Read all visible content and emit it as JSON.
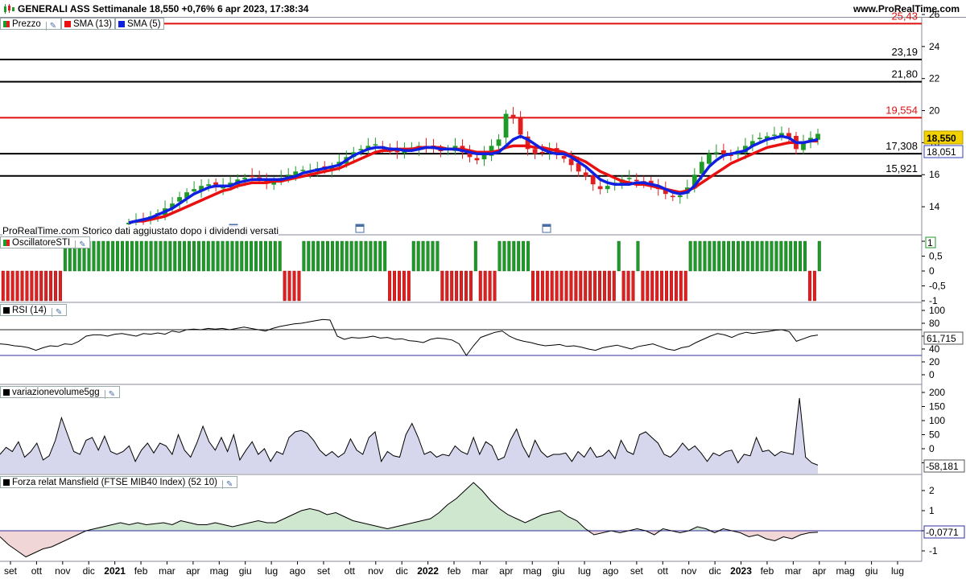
{
  "header": {
    "title": "GENERALI ASS Settimanale 18,550 +0,76% 6 apr 2023, 17:38:34",
    "site": "www.ProRealTime.com"
  },
  "colors": {
    "up": "#1e9a28",
    "down": "#e02020",
    "sma13": "#e81010",
    "sma5": "#1020e0",
    "hline_black": "#000000",
    "hline_red": "#e01010",
    "panel_border": "#8a8a9a",
    "area_fill": "#d6d6ec",
    "green_fill": "#cfe6cf",
    "red_fill": "#f0d6d6",
    "blue_line": "#3030a0"
  },
  "legends": {
    "price": "Prezzo",
    "sma13": "SMA (13)",
    "sma5": "SMA (5)",
    "sti": "OscillatoreSTI",
    "rsi": "RSI (14)",
    "vol": "variazionevolume5gg",
    "mansfield": "Forza relat Mansfield (FTSE MIB40 Index) (52 10)"
  },
  "note": "ProRealTime.com  Storico dati aggiustato dopo i dividendi versati",
  "icons": [
    "wrench-icon",
    "calendar-icon"
  ],
  "chart_data": [
    {
      "type": "candlestick",
      "title": "GENERALI ASS Settimanale",
      "ylim": [
        13,
        26
      ],
      "y_ticks": [
        "14",
        "16",
        "18",
        "20",
        "22",
        "24",
        "26"
      ],
      "horizontal_lines": [
        {
          "value": 25.43,
          "label": "25,43",
          "color": "red"
        },
        {
          "value": 23.19,
          "label": "23,19",
          "color": "black"
        },
        {
          "value": 21.8,
          "label": "21,80",
          "color": "black"
        },
        {
          "value": 19.554,
          "label": "19,554",
          "color": "red"
        },
        {
          "value": 17.308,
          "label": "17,308",
          "color": "black"
        },
        {
          "value": 15.921,
          "label": "15,921",
          "color": "black"
        }
      ],
      "last_price": "18,550",
      "sma_value": "18,051",
      "closes": [
        13.0,
        13.1,
        13.2,
        13.4,
        13.6,
        13.9,
        14.2,
        14.6,
        14.9,
        15.1,
        15.3,
        15.4,
        15.2,
        15.3,
        15.5,
        15.7,
        15.8,
        15.9,
        15.7,
        15.5,
        15.6,
        15.8,
        16.0,
        16.2,
        16.3,
        16.2,
        16.4,
        16.3,
        16.5,
        16.8,
        17.1,
        17.4,
        17.6,
        17.8,
        17.9,
        17.7,
        17.5,
        17.4,
        17.6,
        17.7,
        17.8,
        17.7,
        17.6,
        17.5,
        17.6,
        17.8,
        17.4,
        17.1,
        16.9,
        17.3,
        17.8,
        18.2,
        19.8,
        19.5,
        18.5,
        17.6,
        17.3,
        17.4,
        17.6,
        17.3,
        17.0,
        16.6,
        16.2,
        15.9,
        15.4,
        15.1,
        15.3,
        15.5,
        15.7,
        15.8,
        15.6,
        15.5,
        15.3,
        15.1,
        14.8,
        14.6,
        14.7,
        15.2,
        16.0,
        16.8,
        17.3,
        17.4,
        17.3,
        17.2,
        17.5,
        17.8,
        18.1,
        18.3,
        18.4,
        18.5,
        18.6,
        18.3,
        17.6,
        18.0,
        18.3,
        18.55
      ],
      "sma13": [
        13.0,
        13.1,
        13.1,
        13.2,
        13.3,
        13.4,
        13.6,
        13.8,
        14.0,
        14.2,
        14.4,
        14.6,
        14.8,
        15.0,
        15.1,
        15.3,
        15.4,
        15.5,
        15.5,
        15.5,
        15.6,
        15.6,
        15.7,
        15.8,
        15.9,
        16.0,
        16.1,
        16.2,
        16.3,
        16.4,
        16.6,
        16.8,
        17.0,
        17.2,
        17.4,
        17.5,
        17.5,
        17.6,
        17.6,
        17.6,
        17.7,
        17.7,
        17.7,
        17.7,
        17.6,
        17.6,
        17.6,
        17.5,
        17.4,
        17.4,
        17.4,
        17.5,
        17.7,
        17.8,
        17.8,
        17.8,
        17.7,
        17.7,
        17.6,
        17.5,
        17.4,
        17.2,
        17.0,
        16.8,
        16.5,
        16.2,
        16.0,
        15.8,
        15.6,
        15.5,
        15.4,
        15.4,
        15.3,
        15.2,
        15.1,
        15.0,
        14.9,
        15.0,
        15.2,
        15.5,
        15.8,
        16.1,
        16.4,
        16.7,
        16.9,
        17.1,
        17.3,
        17.5,
        17.7,
        17.8,
        17.9,
        18.0,
        18.0,
        18.0,
        18.1,
        18.1
      ],
      "sma5": [
        13.0,
        13.1,
        13.2,
        13.3,
        13.5,
        13.7,
        13.9,
        14.2,
        14.5,
        14.8,
        15.0,
        15.2,
        15.3,
        15.3,
        15.3,
        15.5,
        15.6,
        15.7,
        15.7,
        15.7,
        15.7,
        15.7,
        15.8,
        15.9,
        16.1,
        16.2,
        16.3,
        16.4,
        16.5,
        16.6,
        16.9,
        17.2,
        17.4,
        17.6,
        17.7,
        17.7,
        17.6,
        17.6,
        17.5,
        17.5,
        17.6,
        17.7,
        17.7,
        17.6,
        17.6,
        17.6,
        17.5,
        17.4,
        17.3,
        17.3,
        17.3,
        17.4,
        17.8,
        18.2,
        18.4,
        18.2,
        17.9,
        17.6,
        17.4,
        17.3,
        17.3,
        17.1,
        16.8,
        16.5,
        16.1,
        15.7,
        15.5,
        15.4,
        15.4,
        15.4,
        15.5,
        15.5,
        15.4,
        15.3,
        15.1,
        14.9,
        14.8,
        14.9,
        15.3,
        15.9,
        16.5,
        16.9,
        17.2,
        17.3,
        17.4,
        17.5,
        17.8,
        18.0,
        18.2,
        18.3,
        18.4,
        18.3,
        18.0,
        18.0,
        18.1,
        18.2
      ]
    },
    {
      "type": "bar",
      "title": "OscillatoreSTI",
      "ylim": [
        -1,
        1
      ],
      "y_ticks": [
        "1",
        "0,5",
        "0",
        "-0,5",
        "-1"
      ],
      "last_value": "1",
      "values": [
        -1,
        -1,
        -1,
        -1,
        -1,
        -1,
        -1,
        -1,
        -1,
        -1,
        -1,
        -1,
        -1,
        1,
        1,
        1,
        1,
        1,
        1,
        1,
        1,
        1,
        1,
        1,
        1,
        1,
        1,
        1,
        1,
        1,
        1,
        1,
        1,
        1,
        1,
        1,
        1,
        1,
        1,
        1,
        1,
        1,
        1,
        1,
        1,
        1,
        1,
        1,
        1,
        1,
        1,
        1,
        1,
        1,
        1,
        1,
        1,
        1,
        1,
        -1,
        -1,
        -1,
        -1,
        1,
        1,
        1,
        1,
        1,
        1,
        1,
        1,
        1,
        1,
        1,
        1,
        1,
        1,
        1,
        1,
        1,
        1,
        -1,
        -1,
        -1,
        -1,
        -1,
        1,
        1,
        1,
        1,
        1,
        1,
        -1,
        -1,
        -1,
        -1,
        -1,
        -1,
        -1,
        1,
        -1,
        -1,
        -1,
        -1,
        1,
        1,
        1,
        1,
        1,
        1,
        1,
        -1,
        -1,
        -1,
        -1,
        -1,
        -1,
        -1,
        -1,
        -1,
        -1,
        -1,
        -1,
        -1,
        -1,
        -1,
        -1,
        -1,
        -1,
        1,
        -1,
        -1,
        -1,
        1,
        -1,
        -1,
        -1,
        -1,
        -1,
        -1,
        -1,
        -1,
        -1,
        -1,
        1,
        1,
        1,
        1,
        1,
        1,
        1,
        1,
        1,
        1,
        1,
        1,
        1,
        1,
        1,
        1,
        1,
        1,
        1,
        1,
        1,
        1,
        1,
        1,
        1,
        -1,
        -1,
        1
      ]
    },
    {
      "type": "line",
      "title": "RSI (14)",
      "ylim": [
        0,
        100
      ],
      "y_ticks": [
        "100",
        "80",
        "60",
        "40",
        "20",
        "0"
      ],
      "levels": [
        70,
        30
      ],
      "last_value": "61,715",
      "values": [
        48,
        47,
        45,
        44,
        42,
        38,
        42,
        45,
        44,
        48,
        47,
        52,
        60,
        62,
        62,
        60,
        63,
        64,
        62,
        60,
        64,
        63,
        65,
        63,
        68,
        66,
        70,
        71,
        70,
        72,
        71,
        72,
        70,
        72,
        74,
        72,
        70,
        68,
        72,
        75,
        77,
        79,
        80,
        82,
        84,
        86,
        85,
        60,
        55,
        58,
        57,
        58,
        60,
        57,
        58,
        55,
        56,
        53,
        52,
        50,
        55,
        57,
        56,
        54,
        48,
        30,
        45,
        58,
        62,
        66,
        68,
        60,
        55,
        52,
        50,
        47,
        45,
        46,
        47,
        44,
        45,
        43,
        40,
        38,
        42,
        44,
        46,
        43,
        40,
        44,
        46,
        48,
        44,
        40,
        38,
        42,
        44,
        50,
        55,
        60,
        64,
        62,
        58,
        63,
        66,
        64,
        66,
        67,
        69,
        70,
        67,
        52,
        56,
        60,
        61.7
      ]
    },
    {
      "type": "area",
      "title": "variazionevolume5gg",
      "ylim": [
        -75,
        200
      ],
      "y_ticks": [
        "200",
        "150",
        "100",
        "50",
        "0",
        "-50"
      ],
      "last_value": "-58,181",
      "values": [
        -20,
        5,
        -10,
        25,
        -30,
        -10,
        20,
        -40,
        -25,
        30,
        110,
        50,
        -10,
        -20,
        30,
        40,
        -5,
        45,
        -10,
        -20,
        -10,
        10,
        -45,
        -5,
        20,
        -15,
        20,
        10,
        -20,
        50,
        -5,
        -30,
        20,
        80,
        25,
        -5,
        40,
        -10,
        50,
        -40,
        -5,
        25,
        -20,
        0,
        -45,
        -10,
        -20,
        40,
        60,
        65,
        55,
        30,
        -5,
        -25,
        -10,
        -30,
        -15,
        35,
        -5,
        -20,
        40,
        60,
        -45,
        -10,
        -25,
        -30,
        50,
        90,
        40,
        -20,
        -10,
        -30,
        -20,
        -25,
        10,
        -10,
        -20,
        40,
        -20,
        25,
        10,
        -40,
        -30,
        30,
        70,
        10,
        -30,
        30,
        -10,
        -30,
        -20,
        -20,
        -15,
        -45,
        -10,
        -30,
        5,
        -30,
        -25,
        -5,
        -35,
        30,
        -10,
        -20,
        50,
        60,
        40,
        20,
        -20,
        -30,
        -10,
        20,
        -5,
        10,
        -15,
        -45,
        -15,
        -25,
        -10,
        -5,
        -50,
        -20,
        -25,
        40,
        -10,
        -5,
        -25,
        -10,
        -15,
        -20,
        180,
        -30,
        -50,
        -58.181
      ]
    },
    {
      "type": "area",
      "title": "Forza relat Mansfield (FTSE MIB40 Index) (52 10)",
      "ylim": [
        -1.4,
        2.6
      ],
      "y_ticks": [
        "2",
        "1",
        "0",
        "-1"
      ],
      "last_value": "-0,0771",
      "values": [
        -0.3,
        -0.7,
        -1.0,
        -1.3,
        -1.1,
        -0.9,
        -0.8,
        -0.6,
        -0.4,
        -0.2,
        0.0,
        0.1,
        0.2,
        0.3,
        0.4,
        0.3,
        0.4,
        0.3,
        0.35,
        0.4,
        0.3,
        0.5,
        0.4,
        0.3,
        0.3,
        0.4,
        0.3,
        0.2,
        0.3,
        0.4,
        0.5,
        0.4,
        0.4,
        0.6,
        0.8,
        1.0,
        1.1,
        1.0,
        0.8,
        0.9,
        0.7,
        0.5,
        0.4,
        0.3,
        0.2,
        0.1,
        0.2,
        0.3,
        0.4,
        0.5,
        0.6,
        0.9,
        1.3,
        1.6,
        2.0,
        2.4,
        2.0,
        1.5,
        1.1,
        0.8,
        0.6,
        0.4,
        0.6,
        0.8,
        0.9,
        1.0,
        0.7,
        0.5,
        0.1,
        -0.2,
        -0.1,
        0.0,
        -0.1,
        0.0,
        0.1,
        0.0,
        -0.2,
        0.1,
        0.0,
        -0.1,
        0.0,
        0.2,
        0.1,
        -0.1,
        0.1,
        0.0,
        -0.1,
        -0.3,
        -0.2,
        -0.4,
        -0.5,
        -0.3,
        -0.4,
        -0.2,
        -0.1,
        -0.0771
      ]
    }
  ],
  "x_axis": {
    "labels": [
      "set",
      "ott",
      "nov",
      "dic",
      "2021",
      "feb",
      "mar",
      "apr",
      "mag",
      "giu",
      "lug",
      "ago",
      "set",
      "ott",
      "nov",
      "dic",
      "2022",
      "feb",
      "mar",
      "apr",
      "mag",
      "giu",
      "lug",
      "ago",
      "set",
      "ott",
      "nov",
      "dic",
      "2023",
      "feb",
      "mar",
      "apr",
      "mag",
      "giu",
      "lug"
    ],
    "bold": [
      "2021",
      "2022",
      "2023"
    ]
  }
}
